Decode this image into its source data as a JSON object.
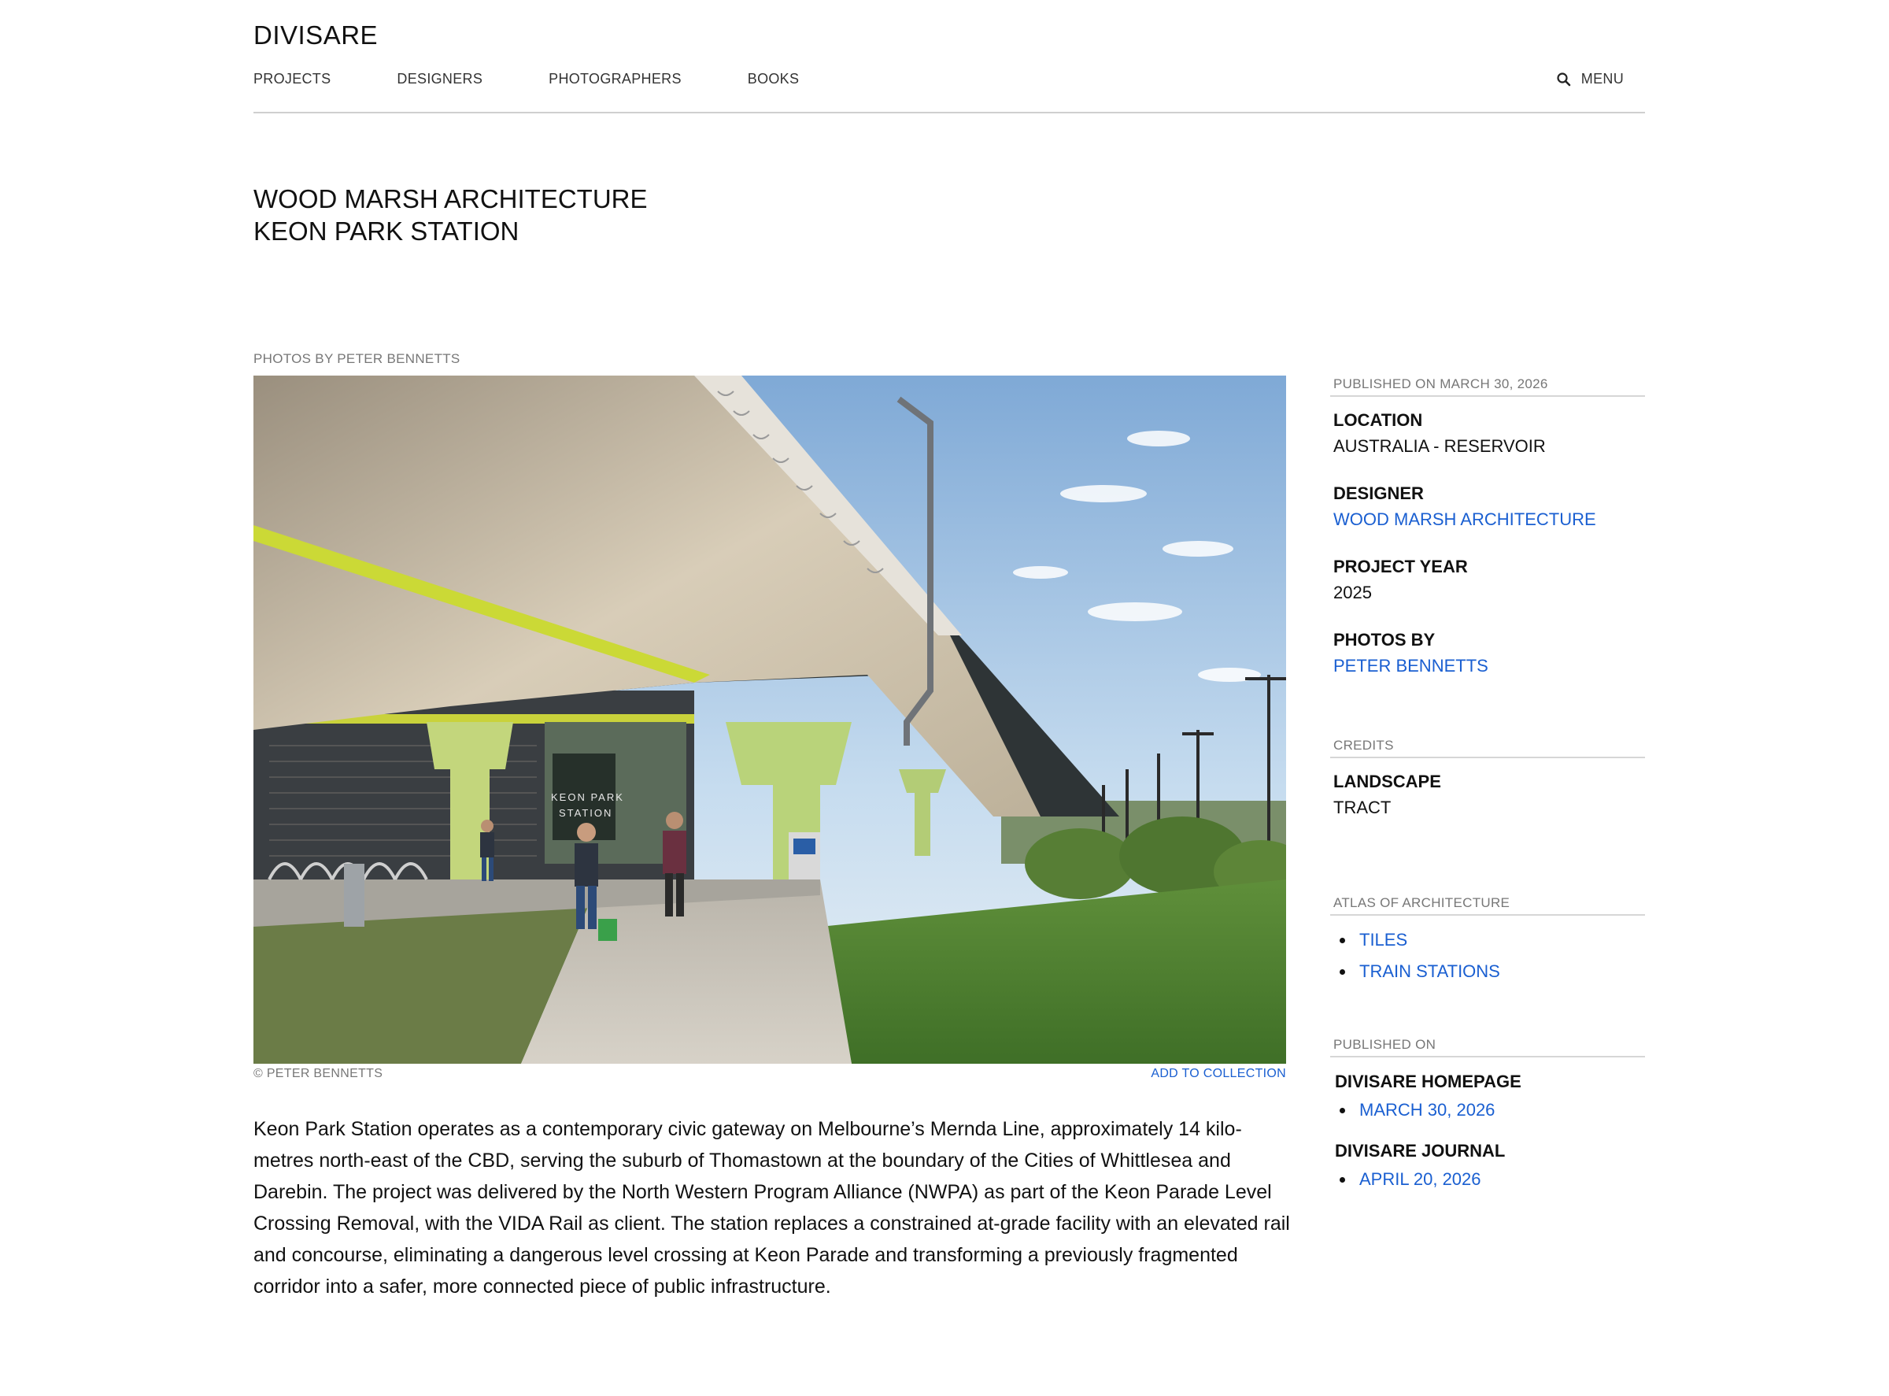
{
  "header": {
    "logo": "DIVISARE",
    "nav": [
      "PROJECTS",
      "DESIGNERS",
      "PHOTOGRAPHERS",
      "BOOKS"
    ],
    "menu_label": "MENU",
    "search_icon": "search-icon"
  },
  "title": {
    "line1": "WOOD MARSH ARCHITECTURE",
    "line2": "KEON PARK STATION"
  },
  "photos_caption": "PHOTOS BY PETER BENNETTS",
  "image": {
    "credit": "© PETER BENNETTS",
    "add_to_collection": "ADD TO COLLECTION",
    "station_sign": "KEON PARK STATION"
  },
  "body_text": "Keon Park Station operates as a contemporary civic gateway on Melbourne’s Mernda Line, approximately 14 kilo­metres north-east of the CBD, serving the suburb of Thomastown at the boundary of the Cities of Whittlesea and Darebin. The project was delivered by the North Western Program Alliance (NWPA) as part of the Keon Parade Lev­el Crossing Removal, with the VIDA Rail as client. The station replaces a constrained at-grade facility with an ele­vated rail and concourse, eliminating a dangerous level crossing at Keon Parade and transforming a previously fragmented corridor into a safer, more connected piece of public infrastructure.",
  "sidebar": {
    "published_on_label": "PUBLISHED ON MARCH 30, 2026",
    "location_key": "LOCATION",
    "location_val": "AUSTRALIA - RESERVOIR",
    "designer_key": "DESIGNER",
    "designer_val": "WOOD MARSH ARCHITECTURE",
    "year_key": "PROJECT YEAR",
    "year_val": "2025",
    "photos_key": "PHOTOS BY",
    "photos_val": "PETER BENNETTS",
    "credits_label": "CREDITS",
    "landscape_key": "LANDSCAPE",
    "landscape_val": "TRACT",
    "atlas_label": "ATLAS OF ARCHITECTURE",
    "atlas_items": [
      "TILES",
      "TRAIN STATIONS"
    ],
    "published_label": "PUBLISHED ON",
    "homepage_key": "DIVISARE HOMEPAGE",
    "homepage_date": "MARCH 30, 2026",
    "journal_key": "DIVISARE JOURNAL",
    "journal_date": "APRIL 20, 2026"
  },
  "colors": {
    "link": "#1a5fd1",
    "muted": "#777777",
    "rule": "#cfcfcf"
  }
}
